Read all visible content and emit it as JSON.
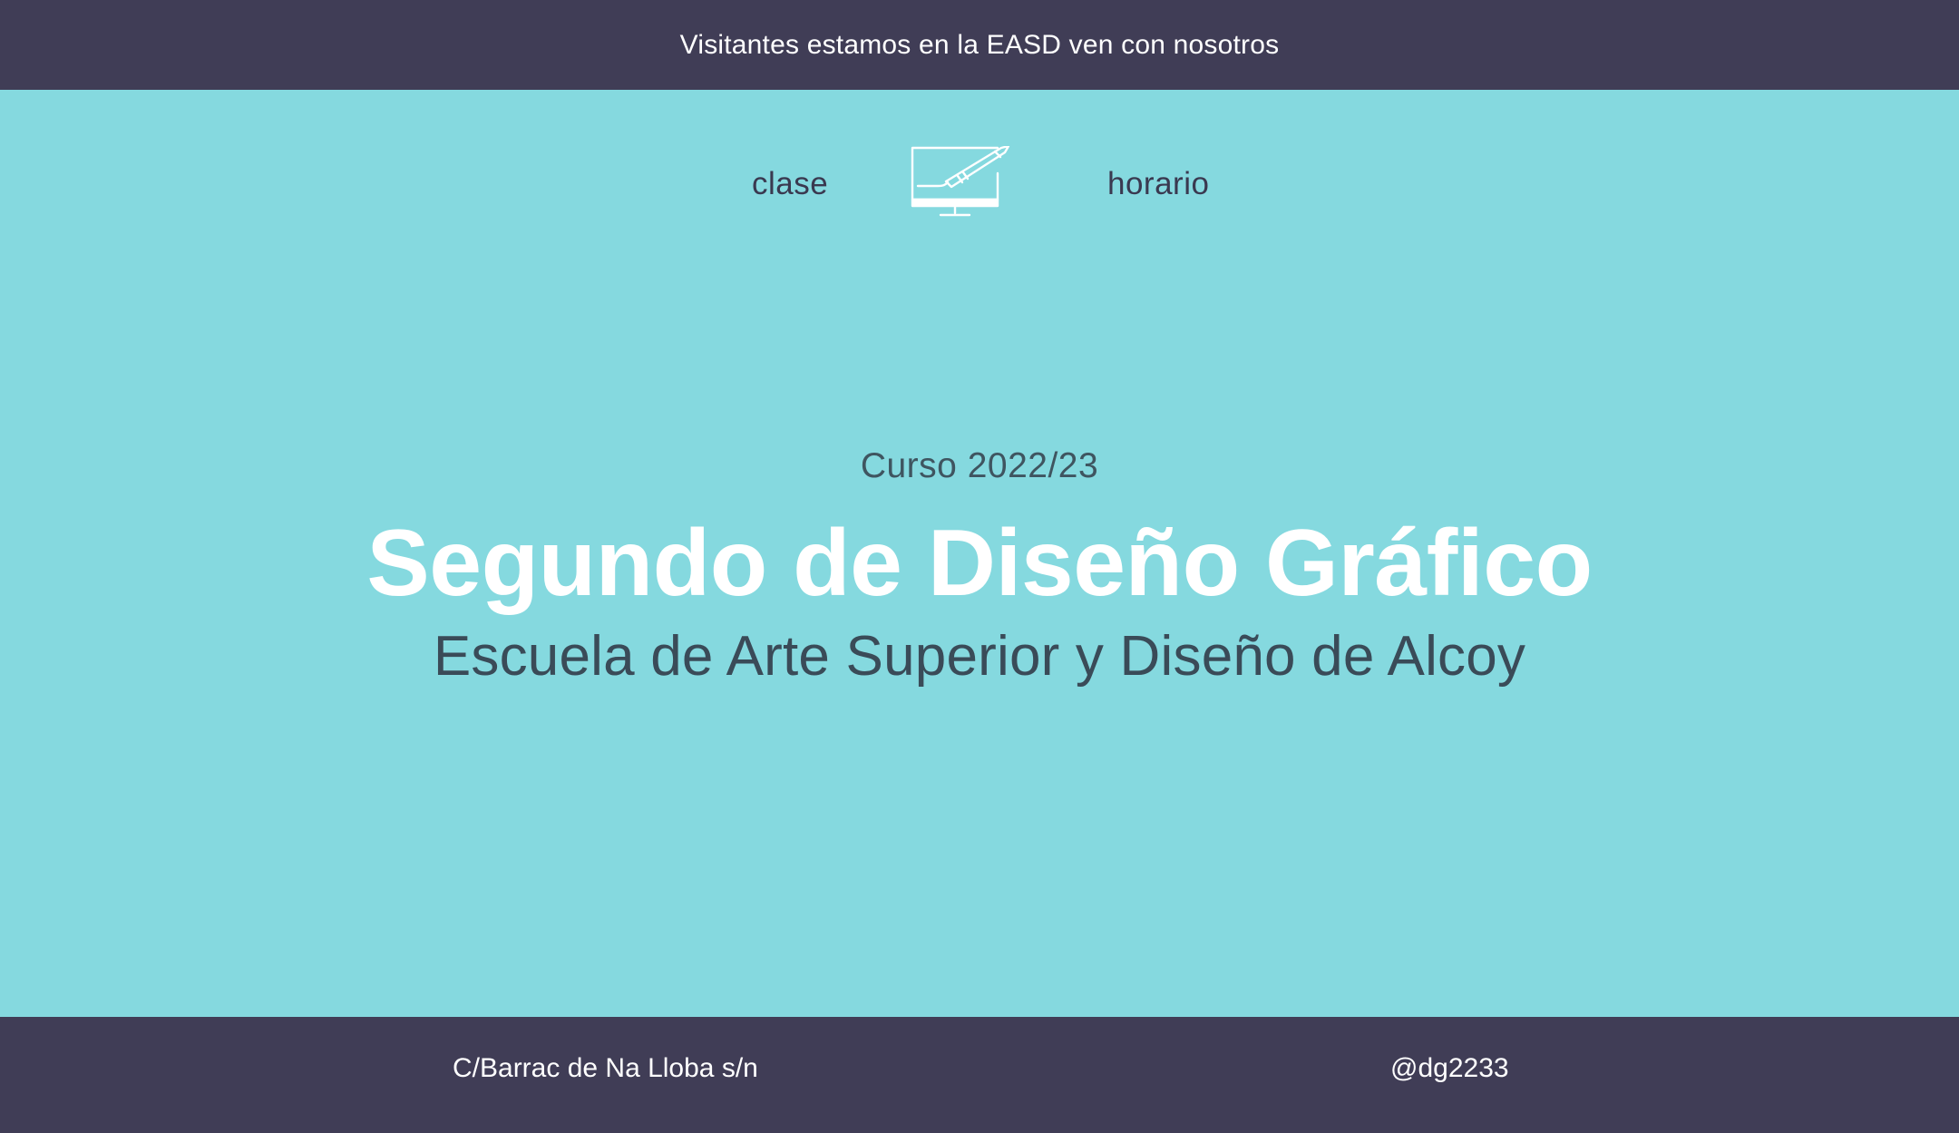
{
  "announcement": {
    "text": "Visitantes estamos en la EASD ven con nosotros"
  },
  "nav": {
    "left_link": "clase",
    "right_link": "horario",
    "logo_icon": "monitor-with-pen-icon"
  },
  "hero": {
    "course": "Curso 2022/23",
    "title": "Segundo de Diseño Gráfico",
    "school": "Escuela de Arte Superior y Diseño de Alcoy"
  },
  "footer": {
    "address": "C/Barrac de Na Lloba s/n",
    "handle": "@dg2233"
  },
  "colors": {
    "background": "#85d9df",
    "bars": "#403d56",
    "white": "#ffffff",
    "dark_text": "#3a3950"
  }
}
